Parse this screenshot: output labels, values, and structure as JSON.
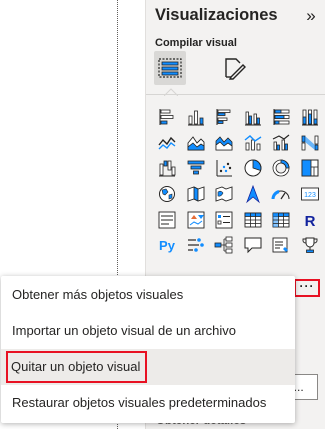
{
  "pane": {
    "title": "Visualizaciones",
    "collapse_icon": "»",
    "section_label": "Compilar visual",
    "tabs": [
      {
        "name": "build-visual-icon",
        "selected": true
      },
      {
        "name": "format-visual-icon",
        "selected": false
      }
    ]
  },
  "visual_icons": [
    "stacked-bar-chart-icon",
    "stacked-column-chart-icon",
    "clustered-bar-chart-icon",
    "clustered-column-chart-icon",
    "100-stacked-bar-chart-icon",
    "100-stacked-column-chart-icon",
    "line-chart-icon",
    "area-chart-icon",
    "stacked-area-chart-icon",
    "line-and-column-chart-icon",
    "line-and-clustered-column-chart-icon",
    "ribbon-chart-icon",
    "waterfall-chart-icon",
    "funnel-chart-icon",
    "scatter-chart-icon",
    "pie-chart-icon",
    "donut-chart-icon",
    "treemap-icon",
    "map-icon",
    "filled-map-icon",
    "shape-map-icon",
    "azure-map-icon",
    "gauge-icon",
    "card-icon",
    "multi-row-card-icon",
    "kpi-icon",
    "slicer-icon",
    "table-icon",
    "matrix-icon",
    "r-visual-icon",
    "python-visual-icon",
    "key-influencers-icon",
    "decomposition-tree-icon",
    "qa-icon",
    "smart-narrative-icon",
    "trophy-icon"
  ],
  "card_text": "123",
  "r_text": "R",
  "python_text": "Py",
  "more_button": "···",
  "context_menu": {
    "items": [
      {
        "label": "Obtener más objetos visuales"
      },
      {
        "label": "Importar un objeto visual de un archivo"
      },
      {
        "label": "Quitar un objeto visual"
      },
      {
        "label": "Restaurar objetos visuales predeterminados"
      }
    ]
  },
  "field_partial": "a...",
  "section_partial": "Obtener detalles",
  "colors": {
    "accent_blue": "#118dff",
    "dark_blue": "#12239e",
    "orange": "#e66c37",
    "highlight_red": "#e81123"
  }
}
